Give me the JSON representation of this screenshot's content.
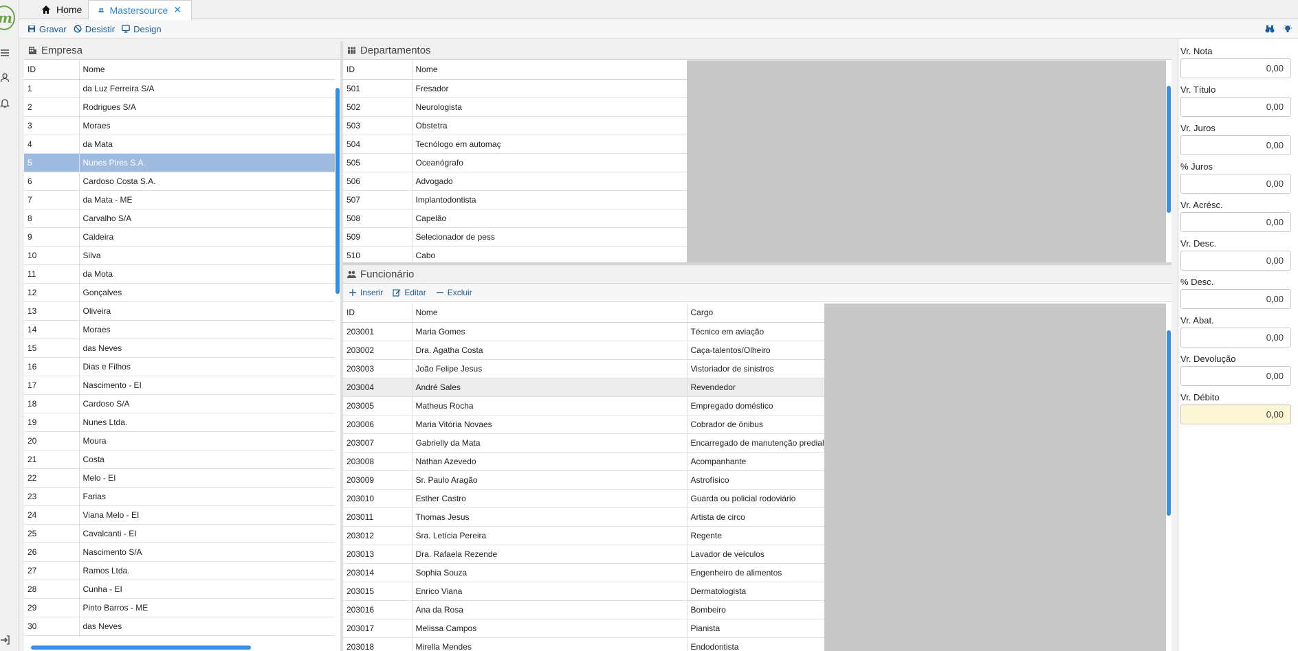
{
  "tabs": {
    "home": "Home",
    "active": "Mastersource"
  },
  "toolbar": {
    "save": "Gravar",
    "cancel": "Desistir",
    "design": "Design"
  },
  "empresa": {
    "title": "Empresa",
    "columns": [
      "ID",
      "Nome"
    ],
    "selected_id": "5",
    "rows": [
      [
        "1",
        "da Luz Ferreira S/A"
      ],
      [
        "2",
        "Rodrigues S/A"
      ],
      [
        "3",
        "Moraes"
      ],
      [
        "4",
        "da Mata"
      ],
      [
        "5",
        "Nunes Pires S.A."
      ],
      [
        "6",
        "Cardoso Costa S.A."
      ],
      [
        "7",
        "da Mata - ME"
      ],
      [
        "8",
        "Carvalho S/A"
      ],
      [
        "9",
        "Caldeira"
      ],
      [
        "10",
        "Silva"
      ],
      [
        "11",
        "da Mota"
      ],
      [
        "12",
        "Gonçalves"
      ],
      [
        "13",
        "Oliveira"
      ],
      [
        "14",
        "Moraes"
      ],
      [
        "15",
        "das Neves"
      ],
      [
        "16",
        "Dias e Filhos"
      ],
      [
        "17",
        "Nascimento - EI"
      ],
      [
        "18",
        "Cardoso S/A"
      ],
      [
        "19",
        "Nunes Ltda."
      ],
      [
        "20",
        "Moura"
      ],
      [
        "21",
        "Costa"
      ],
      [
        "22",
        "Melo - EI"
      ],
      [
        "23",
        "Farias"
      ],
      [
        "24",
        "Viana Melo - EI"
      ],
      [
        "25",
        "Cavalcanti - EI"
      ],
      [
        "26",
        "Nascimento S/A"
      ],
      [
        "27",
        "Ramos Ltda."
      ],
      [
        "28",
        "Cunha - EI"
      ],
      [
        "29",
        "Pinto Barros - ME"
      ],
      [
        "30",
        "das Neves"
      ]
    ]
  },
  "departamentos": {
    "title": "Departamentos",
    "columns": [
      "ID",
      "Nome"
    ],
    "rows": [
      [
        "501",
        "Fresador"
      ],
      [
        "502",
        "Neurologista"
      ],
      [
        "503",
        "Obstetra"
      ],
      [
        "504",
        "Tecnólogo em automaç"
      ],
      [
        "505",
        "Oceanógrafo"
      ],
      [
        "506",
        "Advogado"
      ],
      [
        "507",
        "Implantodontista"
      ],
      [
        "508",
        "Capelão"
      ],
      [
        "509",
        "Selecionador de pess"
      ],
      [
        "510",
        "Cabo"
      ]
    ]
  },
  "funcionario": {
    "title": "Funcionário",
    "actions": {
      "insert": "Inserir",
      "edit": "Editar",
      "delete": "Excluir"
    },
    "columns": [
      "ID",
      "Nome",
      "Cargo"
    ],
    "highlighted_id": "203004",
    "rows": [
      [
        "203001",
        "Maria Gomes",
        "Técnico em aviação"
      ],
      [
        "203002",
        "Dra. Agatha Costa",
        "Caça-talentos/Olheiro"
      ],
      [
        "203003",
        "João Felipe Jesus",
        "Vistoriador de sinistros"
      ],
      [
        "203004",
        "André Sales",
        "Revendedor"
      ],
      [
        "203005",
        "Matheus Rocha",
        "Empregado doméstico"
      ],
      [
        "203006",
        "Maria Vitória Novaes",
        "Cobrador de ônibus"
      ],
      [
        "203007",
        "Gabrielly da Mata",
        "Encarregado de manutenção predial"
      ],
      [
        "203008",
        "Nathan Azevedo",
        "Acompanhante"
      ],
      [
        "203009",
        "Sr. Paulo Aragão",
        "Astrofísico"
      ],
      [
        "203010",
        "Esther Castro",
        "Guarda ou policial rodoviário"
      ],
      [
        "203011",
        "Thomas Jesus",
        "Artista de circo"
      ],
      [
        "203012",
        "Sra. Letícia Pereira",
        "Regente"
      ],
      [
        "203013",
        "Dra. Rafaela Rezende",
        "Lavador de veículos"
      ],
      [
        "203014",
        "Sophia Souza",
        "Engenheiro de alimentos"
      ],
      [
        "203015",
        "Enrico Viana",
        "Dermatologista"
      ],
      [
        "203016",
        "Ana da Rosa",
        "Bombeiro"
      ],
      [
        "203017",
        "Melissa Campos",
        "Pianista"
      ],
      [
        "203018",
        "Mirella Mendes",
        "Endodontista"
      ]
    ]
  },
  "values": [
    {
      "key": "vr-nota",
      "label": "Vr. Nota",
      "value": "0,00"
    },
    {
      "key": "vr-titulo",
      "label": "Vr. Título",
      "value": "0,00"
    },
    {
      "key": "vr-juros",
      "label": "Vr. Juros",
      "value": "0,00"
    },
    {
      "key": "pct-juros",
      "label": "% Juros",
      "value": "0,00"
    },
    {
      "key": "vr-acresc",
      "label": "Vr. Acrésc.",
      "value": "0,00"
    },
    {
      "key": "vr-desc",
      "label": "Vr. Desc.",
      "value": "0,00"
    },
    {
      "key": "pct-desc",
      "label": "% Desc.",
      "value": "0,00"
    },
    {
      "key": "vr-abat",
      "label": "Vr. Abat.",
      "value": "0,00"
    },
    {
      "key": "vr-devolucao",
      "label": "Vr. Devolução",
      "value": "0,00"
    },
    {
      "key": "vr-debito",
      "label": "Vr. Débito",
      "value": "0,00",
      "highlight": true
    }
  ],
  "colors": {
    "accent": "#2b86d6",
    "selection": "#9fbce0",
    "debit_bg": "#fbf6d4",
    "scrollbar": "#3c8fe0"
  },
  "icons": {
    "home": "home-icon",
    "tab": "users-icon",
    "save": "save-icon",
    "cancel": "ban-icon",
    "design": "monitor-icon",
    "find": "binoculars-icon",
    "tip": "lightbulb-icon"
  }
}
